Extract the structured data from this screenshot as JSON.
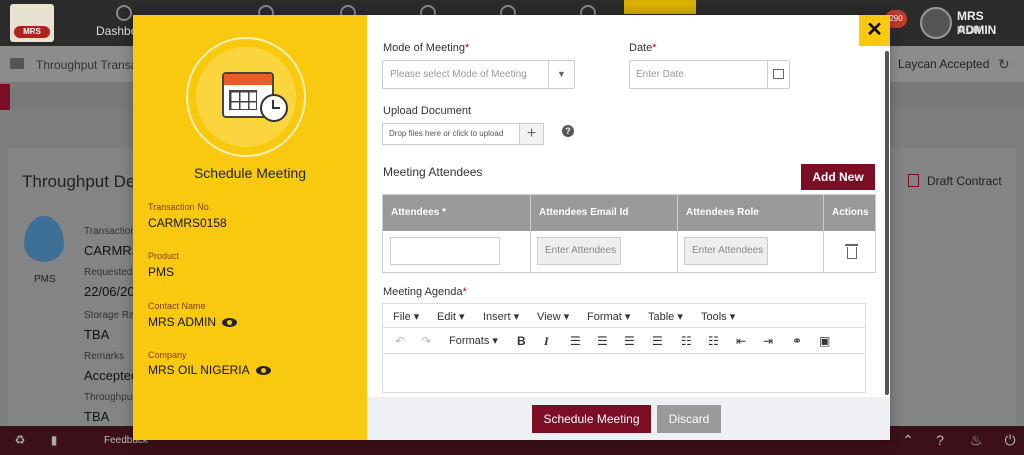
{
  "app": {
    "nav_dashboard": "Dashbo",
    "notifications": "290",
    "user_name": "MRS ADMIN",
    "user_role": "MON",
    "breadcrumb": "Throughput Transa",
    "status": "Laycan Accepted",
    "card_title": "Throughput De",
    "draft_contract": "Draft Contract",
    "product_icon_label": "PMS",
    "bg_fields": [
      {
        "label": "Transaction",
        "value": "CARMRS"
      },
      {
        "label": "Requested",
        "value": "22/06/20"
      },
      {
        "label": "Storage Ra",
        "value": "TBA"
      },
      {
        "label": "Remarks",
        "value": "Accepted"
      },
      {
        "label": "Throughpu",
        "value": "TBA"
      }
    ],
    "feedback": "Feedback",
    "logo_text": "MRS"
  },
  "modal": {
    "title": "Schedule Meeting",
    "details": [
      {
        "label": "Transaction No.",
        "value": "CARMRS0158"
      },
      {
        "label": "Product",
        "value": "PMS"
      },
      {
        "label": "Contact Name",
        "value": "MRS ADMIN"
      },
      {
        "label": "Company",
        "value": "MRS OIL NIGERIA"
      }
    ],
    "mode_label": "Mode of Meeting",
    "mode_placeholder": "Please select Mode of Meeting",
    "date_label": "Date",
    "date_placeholder": "Enter Date",
    "upload_label": "Upload Document",
    "upload_placeholder": "Drop files here or click to upload",
    "attendees_title": "Meeting Attendees",
    "add_new": "Add New",
    "columns": [
      "Attendees *",
      "Attendees Email Id",
      "Attendees Role",
      "Actions"
    ],
    "row": {
      "email_placeholder": "Enter Attendees",
      "role_placeholder": "Enter Attendees"
    },
    "agenda_label": "Meeting Agenda",
    "editor_menu": [
      "File",
      "Edit",
      "Insert",
      "View",
      "Format",
      "Table",
      "Tools"
    ],
    "editor_formats": "Formats",
    "schedule_button": "Schedule Meeting",
    "discard_button": "Discard",
    "close": "✕"
  }
}
